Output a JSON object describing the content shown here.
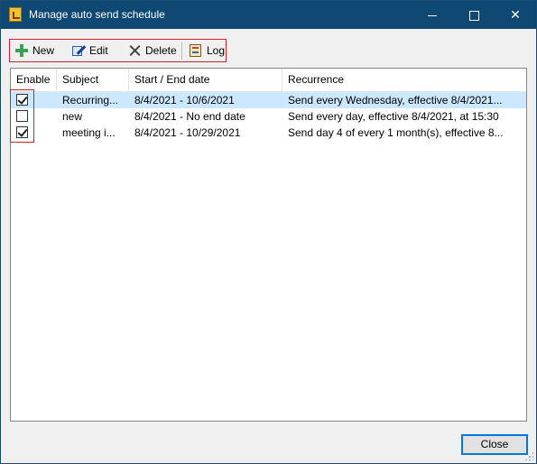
{
  "window": {
    "title": "Manage auto send schedule",
    "controls": {
      "minimize": "minimize-icon",
      "maximize": "maximize-icon",
      "close": "close-icon",
      "close_glyph": "✕"
    }
  },
  "toolbar": {
    "new_label": "New",
    "edit_label": "Edit",
    "delete_label": "Delete",
    "log_label": "Log",
    "icons": {
      "new": "plus-icon",
      "edit": "pencil-icon",
      "delete": "x-icon",
      "log": "log-icon"
    }
  },
  "list": {
    "columns": [
      "Enable",
      "Subject",
      "Start / End date",
      "Recurrence"
    ],
    "rows": [
      {
        "enabled": true,
        "subject": "Recurring...",
        "dates": "8/4/2021 - 10/6/2021",
        "recurrence": "Send every Wednesday, effective 8/4/2021...",
        "selected": true
      },
      {
        "enabled": false,
        "subject": "new",
        "dates": "8/4/2021 - No end date",
        "recurrence": "Send every day, effective 8/4/2021, at 15:30",
        "selected": false
      },
      {
        "enabled": true,
        "subject": "meeting i...",
        "dates": "8/4/2021 - 10/29/2021",
        "recurrence": "Send day 4 of every 1 month(s), effective 8...",
        "selected": false
      }
    ]
  },
  "footer": {
    "close_label": "Close"
  },
  "colors": {
    "titlebar": "#0f4873",
    "highlight_border": "#d0202a",
    "selection": "#cce8ff",
    "accent": "#0078d7"
  }
}
